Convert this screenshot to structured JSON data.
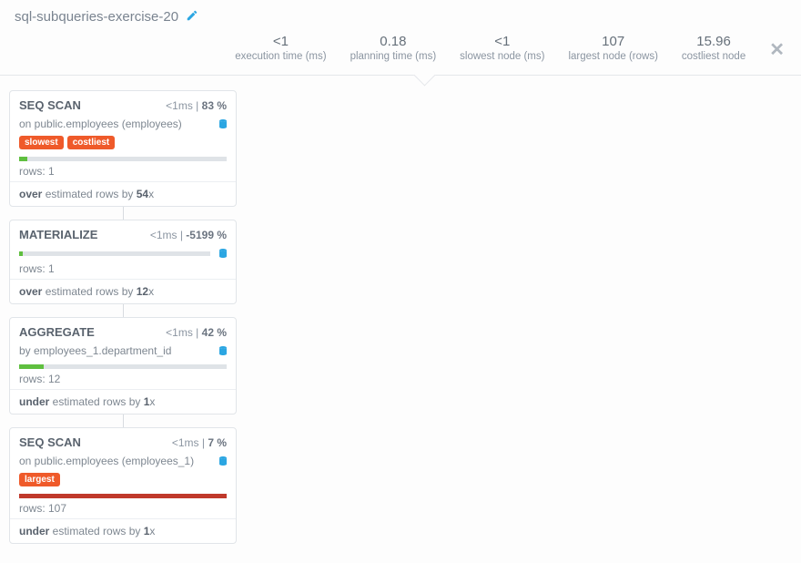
{
  "title": "sql-subqueries-exercise-20",
  "icons": {
    "edit": "edit-icon",
    "close": "close-icon",
    "db": "db-icon"
  },
  "stats": [
    {
      "value": "<1",
      "label": "execution time (ms)"
    },
    {
      "value": "0.18",
      "label": "planning time (ms)"
    },
    {
      "value": "<1",
      "label": "slowest node (ms)"
    },
    {
      "value": "107",
      "label": "largest node (rows)"
    },
    {
      "value": "15.96",
      "label": "costliest node"
    }
  ],
  "nodes": [
    {
      "op": "SEQ SCAN",
      "time": "<1ms",
      "pct": "83 %",
      "sub_prefix": "on ",
      "sub_target": "public.employees (employees)",
      "tags": [
        "slowest",
        "costliest"
      ],
      "bar_class": "green",
      "bar_width": "4%",
      "rows_label": "rows: ",
      "rows": "1",
      "est_dir": "over",
      "est_mid": " estimated rows by ",
      "est_factor": "54",
      "est_suffix": "x",
      "show_db_next_to_sub": true
    },
    {
      "op": "MATERIALIZE",
      "time": "<1ms",
      "pct": "-5199 %",
      "sub_prefix": "",
      "sub_target": "",
      "tags": [],
      "bar_class": "green",
      "bar_width": "2%",
      "rows_label": "rows: ",
      "rows": "1",
      "est_dir": "over",
      "est_mid": " estimated rows by ",
      "est_factor": "12",
      "est_suffix": "x",
      "db_with_bar": true
    },
    {
      "op": "AGGREGATE",
      "time": "<1ms",
      "pct": "42 %",
      "sub_prefix": "by ",
      "sub_target": "employees_1.department_id",
      "tags": [],
      "bar_class": "green",
      "bar_width": "12%",
      "rows_label": "rows: ",
      "rows": "12",
      "est_dir": "under",
      "est_mid": " estimated rows by ",
      "est_factor": "1",
      "est_suffix": "x",
      "show_db_next_to_sub": true
    },
    {
      "op": "SEQ SCAN",
      "time": "<1ms",
      "pct": "7 %",
      "sub_prefix": "on ",
      "sub_target": "public.employees (employees_1)",
      "tags": [
        "largest"
      ],
      "bar_class": "red",
      "bar_width": "100%",
      "rows_label": "rows: ",
      "rows": "107",
      "est_dir": "under",
      "est_mid": " estimated rows by ",
      "est_factor": "1",
      "est_suffix": "x",
      "show_db_next_to_sub": true
    }
  ]
}
